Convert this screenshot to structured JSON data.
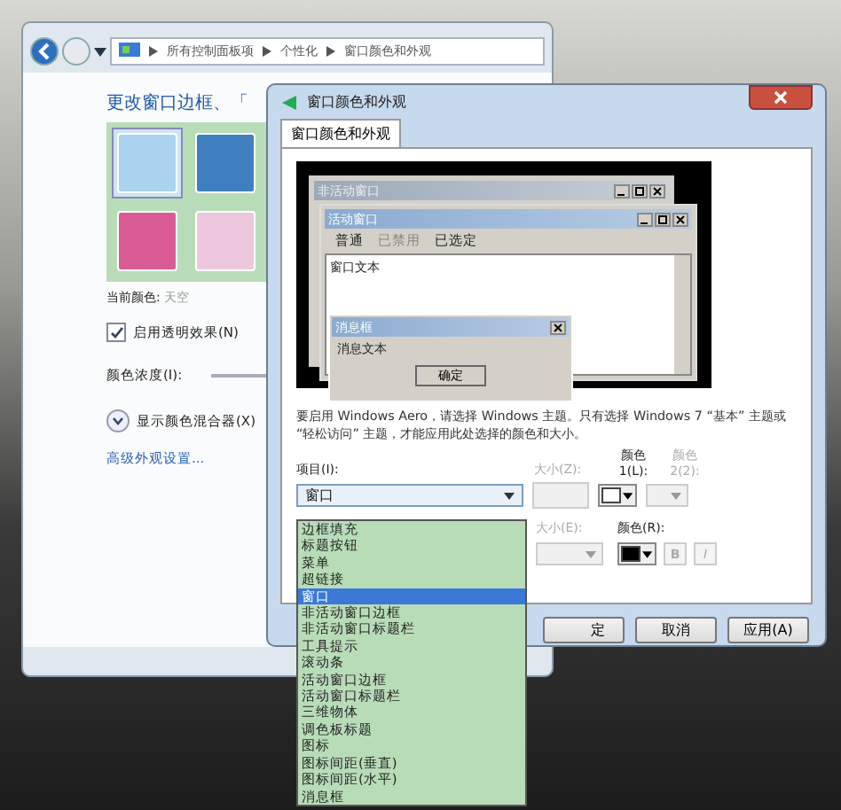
{
  "explorer": {
    "breadcrumb": [
      "所有控制面板项",
      "个性化",
      "窗口颜色和外观"
    ],
    "heading": "更改窗口边框、「",
    "swatches": [
      {
        "color": "#a9d3ee",
        "selected": true
      },
      {
        "color": "#3f7fc0",
        "selected": false
      },
      {
        "color": "#d95b94",
        "selected": false
      },
      {
        "color": "#ecc7dd",
        "selected": false
      }
    ],
    "current_color_label": "当前颜色:",
    "current_color": "天空",
    "transparency": {
      "label": "启用透明效果(N)",
      "checked": true
    },
    "intensity_label": "颜色浓度(I):",
    "mixer": {
      "label": "显示颜色混合器(X)",
      "expanded": false
    },
    "advanced_link": "高级外观设置..."
  },
  "dialog": {
    "title": "窗口颜色和外观",
    "tabs": [
      {
        "label": "窗口颜色和外观",
        "selected": true
      }
    ],
    "preview": {
      "inactive_title": "非活动窗口",
      "active_title": "活动窗口",
      "menu": [
        {
          "label": "普通",
          "disabled": false
        },
        {
          "label": "已禁用",
          "disabled": true
        },
        {
          "label": "已选定",
          "disabled": false
        }
      ],
      "window_text": "窗口文本",
      "message_title": "消息框",
      "message_text": "消息文本",
      "ok": "确定"
    },
    "note": "要启用 Windows Aero，请选择 Windows 主题。只有选择 Windows 7 “基本” 主题或 “轻松访问” 主题，才能应用此处选择的颜色和大小。",
    "item_label": "项目(I):",
    "item_value": "窗口",
    "size1": {
      "label": "大小(Z):",
      "disabled": true
    },
    "color1": {
      "label": "颜色 1(L):",
      "color": "#ffffff"
    },
    "color2": {
      "label": "颜色 2(2):",
      "disabled": true
    },
    "size2": {
      "label": "大小(E):",
      "disabled": true
    },
    "font_color": {
      "label": "颜色(R):",
      "color": "#000000"
    },
    "style_buttons": [
      {
        "label": "B",
        "disabled": true
      },
      {
        "label": "I",
        "disabled": true
      }
    ],
    "buttons": [
      {
        "label": "定"
      },
      {
        "label": "取消"
      },
      {
        "label": "应用(A)"
      }
    ]
  },
  "dropdown": {
    "items": [
      {
        "label": "边框填充",
        "selected": false
      },
      {
        "label": "标题按钮",
        "selected": false
      },
      {
        "label": "菜单",
        "selected": false
      },
      {
        "label": "超链接",
        "selected": false
      },
      {
        "label": "窗口",
        "selected": true
      },
      {
        "label": "非活动窗口边框",
        "selected": false
      },
      {
        "label": "非活动窗口标题栏",
        "selected": false
      },
      {
        "label": "工具提示",
        "selected": false
      },
      {
        "label": "滚动条",
        "selected": false
      },
      {
        "label": "活动窗口边框",
        "selected": false
      },
      {
        "label": "活动窗口标题栏",
        "selected": false
      },
      {
        "label": "三维物体",
        "selected": false
      },
      {
        "label": "调色板标题",
        "selected": false
      },
      {
        "label": "图标",
        "selected": false
      },
      {
        "label": "图标间距(垂直)",
        "selected": false
      },
      {
        "label": "图标间距(水平)",
        "selected": false
      },
      {
        "label": "消息框",
        "selected": false
      }
    ]
  }
}
